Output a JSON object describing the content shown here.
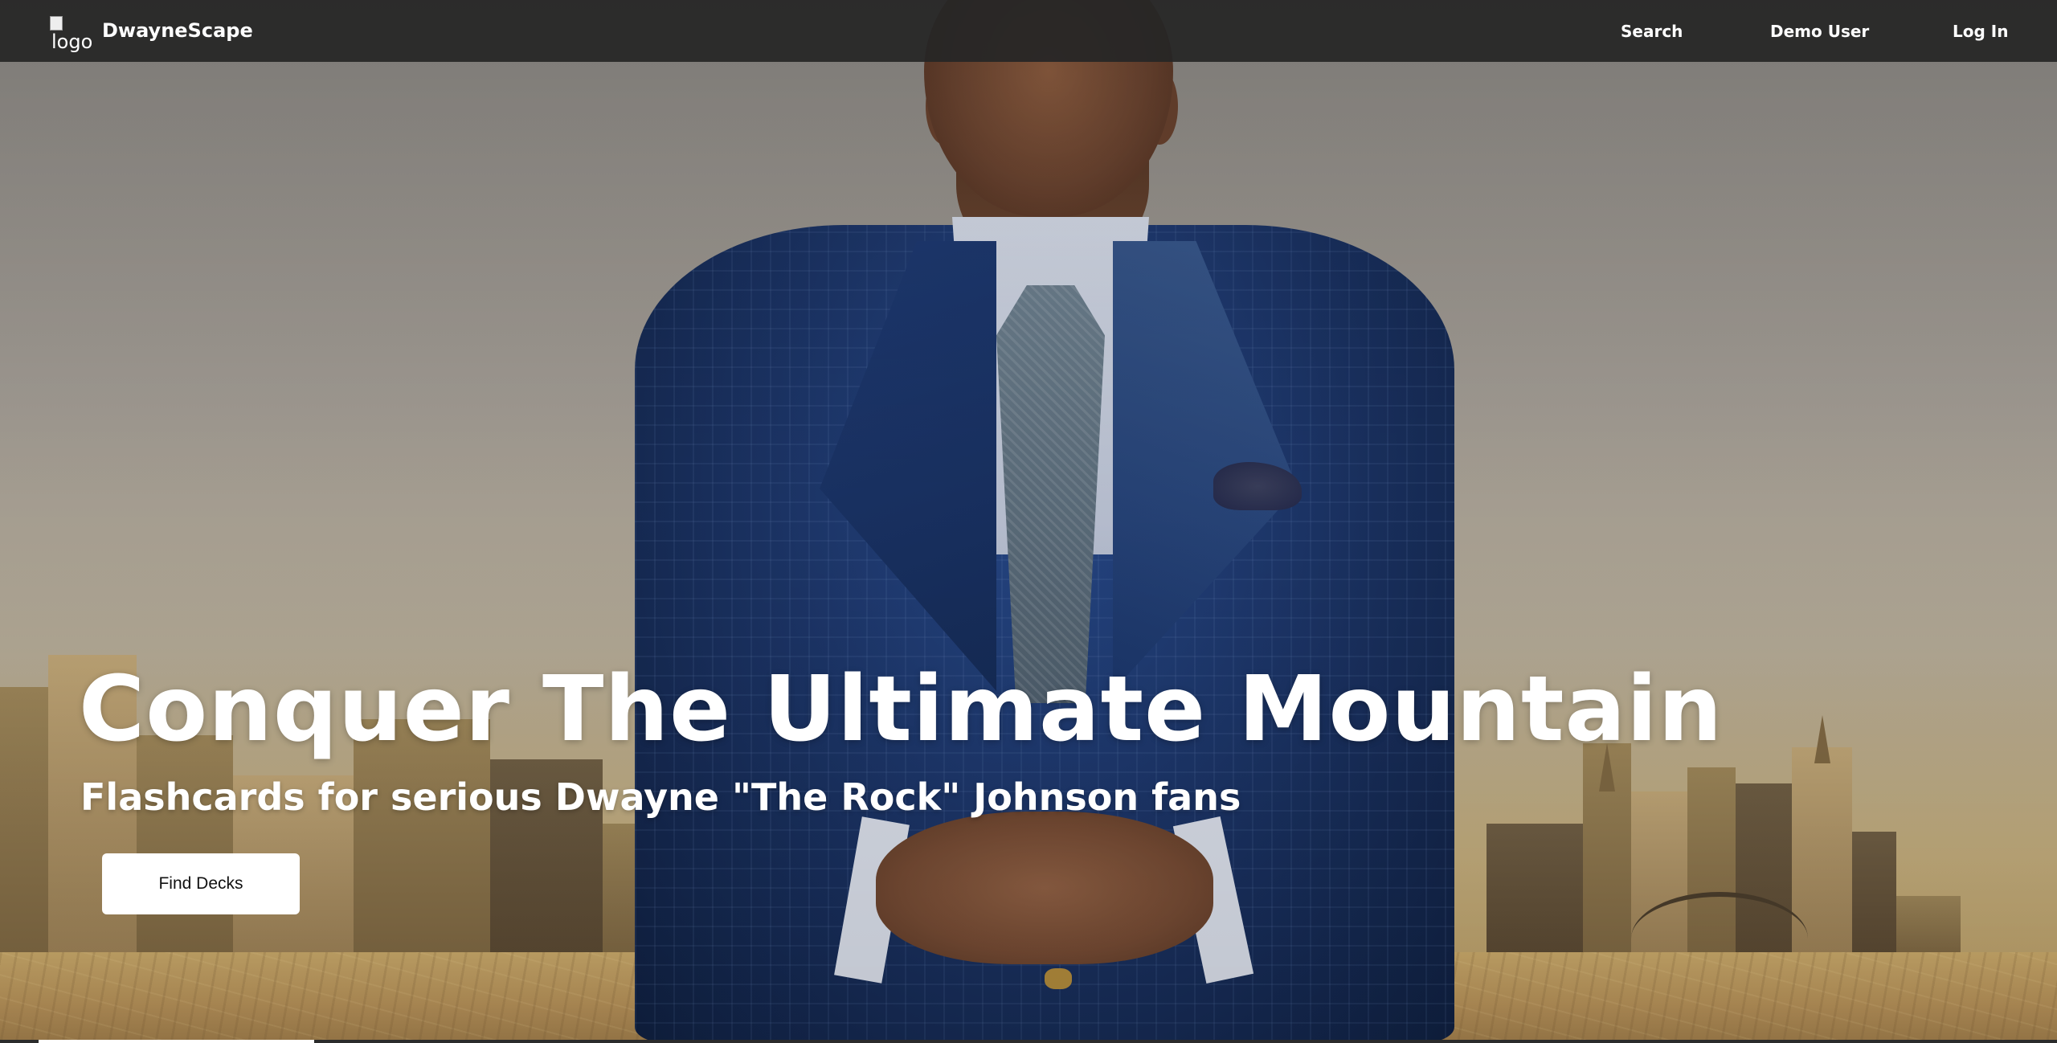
{
  "nav": {
    "logo_alt": "logo",
    "brand": "DwayneScape",
    "links": {
      "search": "Search",
      "demo_user": "Demo User",
      "log_in": "Log In"
    }
  },
  "hero": {
    "headline": "Conquer The Ultimate Mountain",
    "subheadline": "Flashcards for serious Dwayne \"The Rock\" Johnson fans",
    "cta_label": "Find Decks"
  },
  "colors": {
    "navbar": "#262626",
    "cta_background": "#ffffff",
    "text": "#ffffff"
  }
}
